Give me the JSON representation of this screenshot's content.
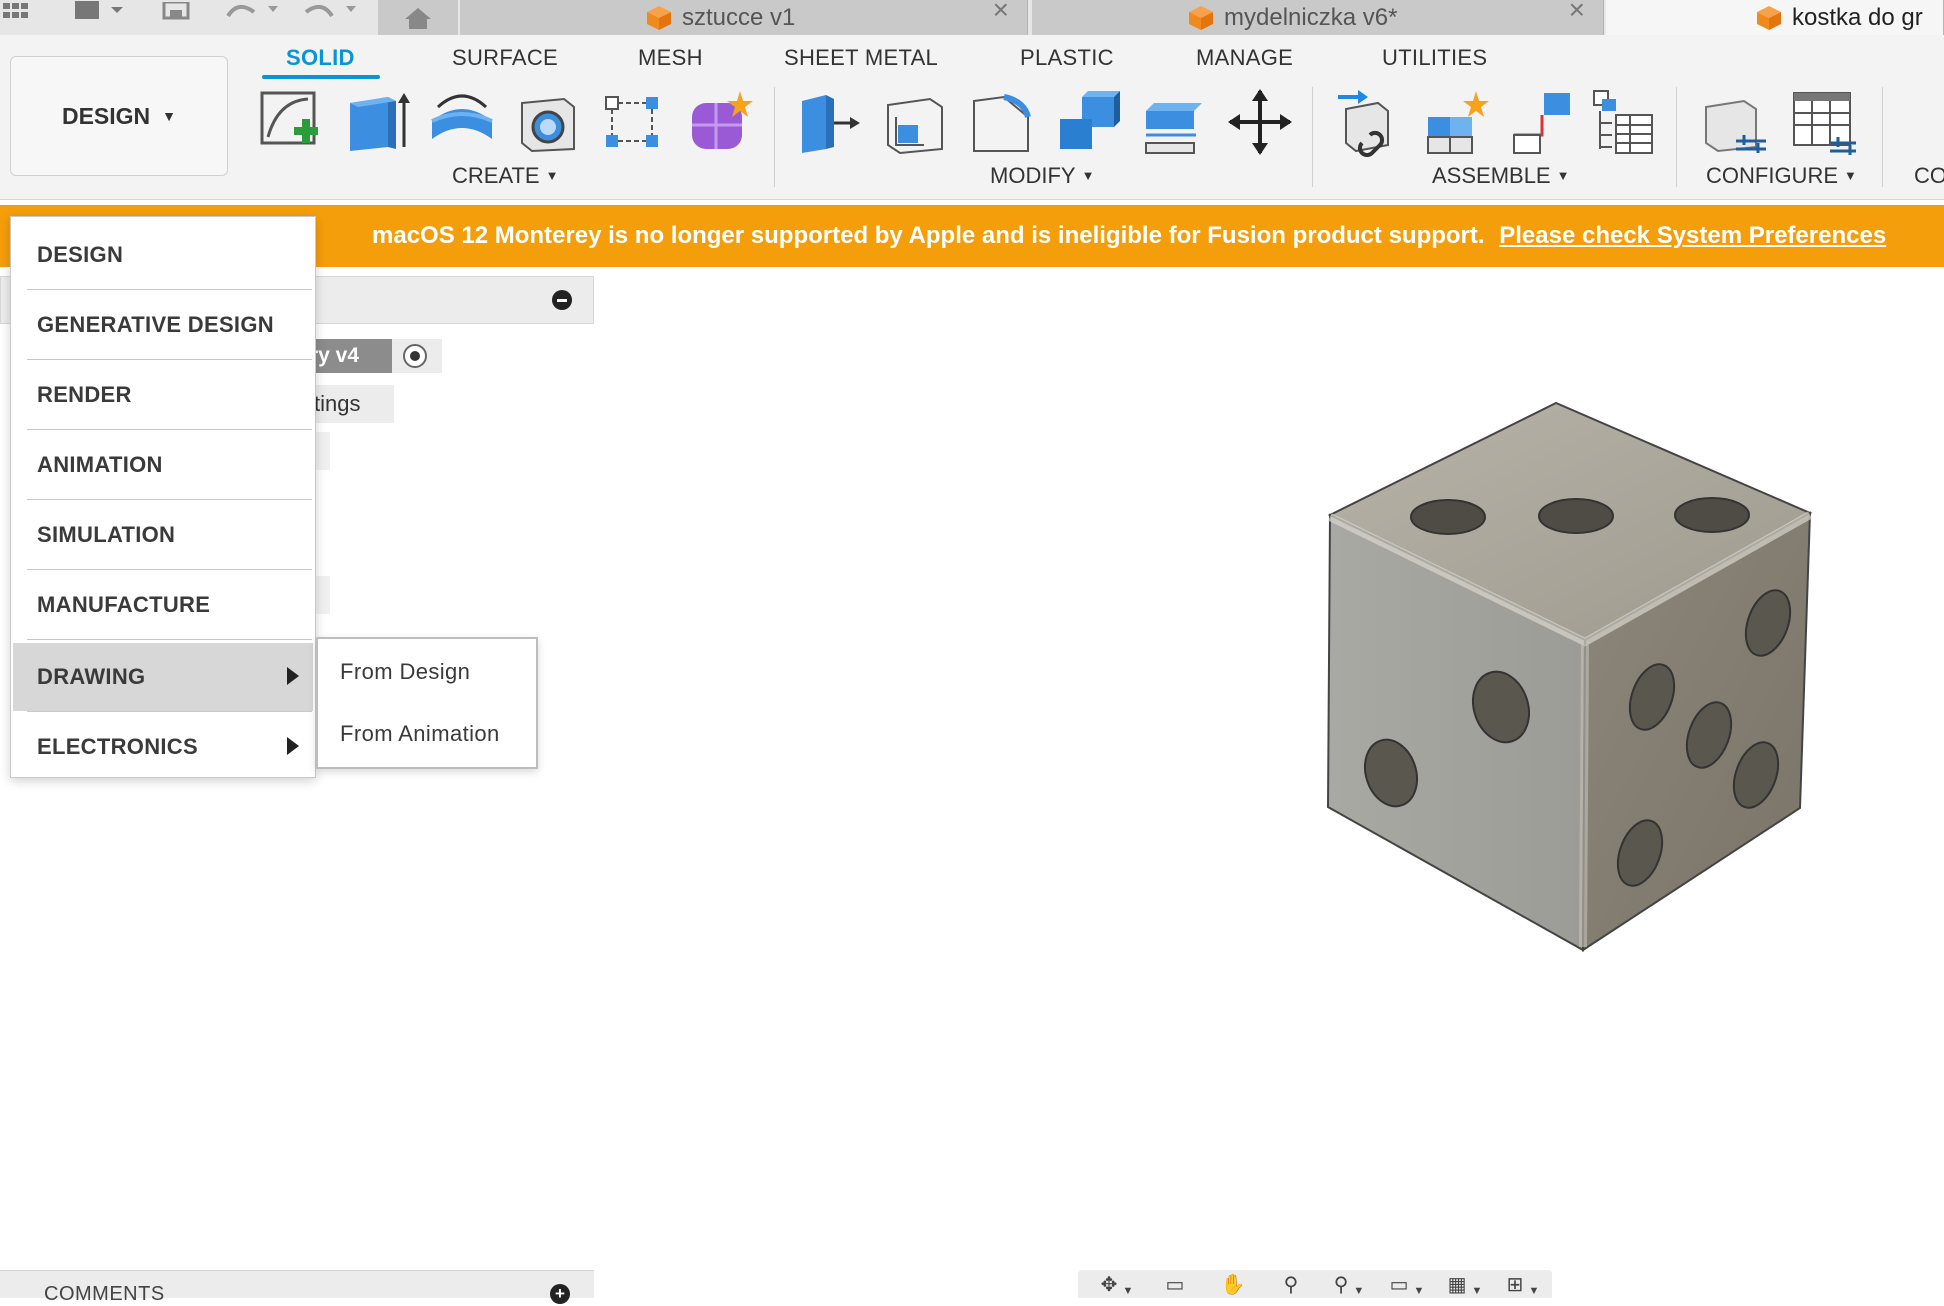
{
  "tabs": {
    "doc_tabs": [
      {
        "title": "sztucce v1"
      },
      {
        "title": "mydelniczka v6*"
      },
      {
        "title": "kostka do gr"
      }
    ]
  },
  "toolbar": {
    "workspace_label": "DESIGN",
    "ribbon_tabs": [
      "SOLID",
      "SURFACE",
      "MESH",
      "SHEET METAL",
      "PLASTIC",
      "MANAGE",
      "UTILITIES"
    ],
    "active_tab": "SOLID",
    "groups": {
      "create": "CREATE",
      "modify": "MODIFY",
      "assemble": "ASSEMBLE",
      "configure": "CONFIGURE",
      "construct_partial": "CO"
    },
    "accent_color": "#0696d7"
  },
  "banner": {
    "text": "macOS 12 Monterey is no longer supported by Apple and is ineligible for Fusion product support.",
    "link": "Please check System Preferences",
    "color": "#f59e0b"
  },
  "browser": {
    "root_node_partial": "ry v4",
    "settings_partial": "tings"
  },
  "workspace_menu": {
    "items": [
      {
        "label": "DESIGN"
      },
      {
        "label": "GENERATIVE DESIGN"
      },
      {
        "label": "RENDER"
      },
      {
        "label": "ANIMATION"
      },
      {
        "label": "SIMULATION"
      },
      {
        "label": "MANUFACTURE"
      },
      {
        "label": "DRAWING"
      },
      {
        "label": "ELECTRONICS"
      }
    ],
    "highlighted": "DRAWING",
    "submenu": [
      "From Design",
      "From Animation"
    ]
  },
  "bottom": {
    "comments_label": "COMMENTS"
  },
  "icons": {
    "navbar": [
      "orbit-icon",
      "look-at-icon",
      "pan-icon",
      "zoom-icon",
      "fit-icon",
      "display-settings-icon",
      "grid-icon",
      "viewports-icon"
    ]
  }
}
